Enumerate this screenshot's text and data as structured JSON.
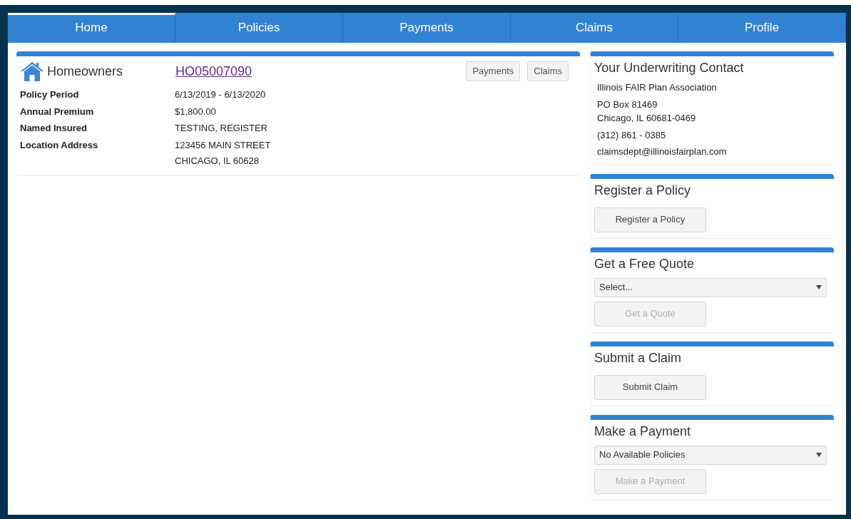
{
  "tabs": [
    {
      "label": "Home",
      "selected": true
    },
    {
      "label": "Policies",
      "selected": false
    },
    {
      "label": "Payments",
      "selected": false
    },
    {
      "label": "Claims",
      "selected": false
    },
    {
      "label": "Profile",
      "selected": false
    }
  ],
  "policy": {
    "type": "Homeowners",
    "number": "HO05007090",
    "buttons": [
      "Payments",
      "Claims"
    ],
    "details": [
      {
        "label": "Policy Period",
        "values": [
          "6/13/2019 - 6/13/2020"
        ]
      },
      {
        "label": "Annual Premium",
        "values": [
          "$1,800.00"
        ]
      },
      {
        "label": "Named Insured",
        "values": [
          "TESTING, REGISTER"
        ]
      },
      {
        "label": "Location Address",
        "values": [
          "123456 MAIN STREET",
          "CHICAGO, IL 60628"
        ]
      }
    ]
  },
  "sidebar": [
    {
      "title": "Your Underwriting Contact",
      "blocks": [
        [
          "Illinois FAIR Plan Association"
        ],
        [
          "PO Box 81469",
          "Chicago, IL 60681-0469"
        ],
        [
          "(312) 861 - 0385"
        ],
        [
          "claimsdept@illinoisfairplan.com"
        ]
      ]
    },
    {
      "title": "Register a Policy",
      "button": {
        "label": "Register a Policy",
        "disabled": false
      }
    },
    {
      "title": "Get a Free Quote",
      "select": {
        "value": "Select..."
      },
      "button": {
        "label": "Get a Quote",
        "disabled": true
      }
    },
    {
      "title": "Submit a Claim",
      "button": {
        "label": "Submit Claim",
        "disabled": false
      }
    },
    {
      "title": "Make a Payment",
      "select": {
        "value": "No Available Policies"
      },
      "button": {
        "label": "Make a Payment",
        "disabled": true
      }
    }
  ]
}
